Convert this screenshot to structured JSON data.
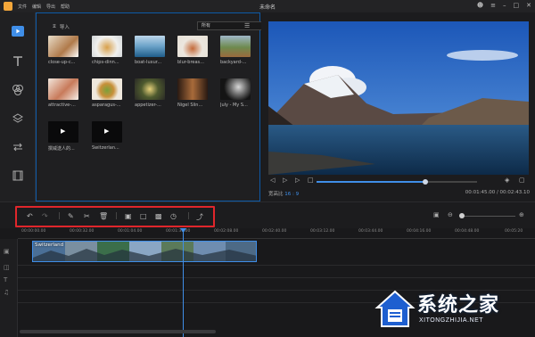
{
  "app": {
    "title": "未命名",
    "menu": [
      "文件",
      "编辑",
      "导出",
      "帮助"
    ]
  },
  "library": {
    "import_label": "导入",
    "filter_value": "所有",
    "thumbs": [
      {
        "label": "close-up-c..."
      },
      {
        "label": "chips-dinn..."
      },
      {
        "label": "boat-luxur..."
      },
      {
        "label": "blur-breas..."
      },
      {
        "label": "backyard-..."
      },
      {
        "label": "attractive-..."
      },
      {
        "label": "asparagus-..."
      },
      {
        "label": "appetizer-..."
      },
      {
        "label": "Nigel Slin..."
      },
      {
        "label": "July - My S..."
      },
      {
        "label": "撰威送人的..."
      },
      {
        "label": "Switzerlan..."
      }
    ]
  },
  "preview": {
    "ratio_label": "宽高比",
    "ratio_value": "16 : 9",
    "timecode": "00:01:45.00 / 00:02:43.10",
    "progress": 0.68
  },
  "timeline": {
    "ruler": [
      "00:00:00.00",
      "00:00:32.00",
      "00:01:04.00",
      "00:01:36.00",
      "00:02:08.00",
      "00:02:40.00",
      "00:03:12.00",
      "00:03:44.00",
      "00:04:16.00",
      "00:04:48.00",
      "00:05:20"
    ],
    "clip_title": "Switzerland"
  },
  "watermark": {
    "cn": "系统之家",
    "en": "XITONGZHIJIA.NET"
  },
  "colors": {
    "accent": "#3f8ee8",
    "highlight_box": "#e0262b",
    "panel_border": "#0d5aa8"
  }
}
